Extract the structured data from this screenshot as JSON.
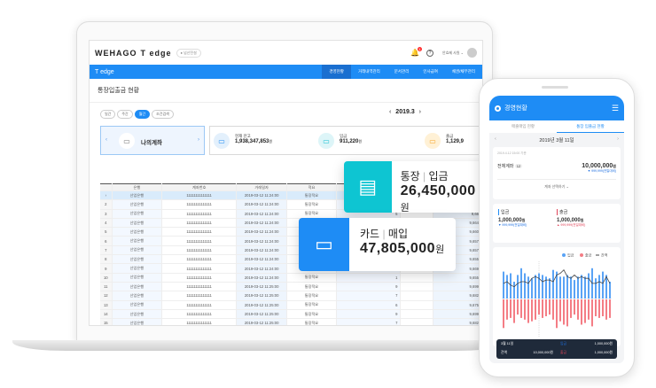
{
  "app": {
    "logo": "WEHAGO",
    "product": "T edge",
    "company_badge": "● 넘산전설",
    "user": "안효제 사원 ⌄",
    "notification_count": "1"
  },
  "nav": {
    "brand": "T edge",
    "items": [
      "경영현황",
      "거래내역관리",
      "문서관리",
      "인사급여",
      "채권/채무관리"
    ]
  },
  "page": {
    "title": "통장입출금 현황",
    "periods": [
      "일간",
      "주간",
      "월간",
      "조건검색"
    ],
    "active_period": "월간",
    "month": "2019.3",
    "prev": "‹",
    "next": "›"
  },
  "account_card": {
    "label": "나의계좌"
  },
  "summary": [
    {
      "label": "현재 잔고",
      "value": "1,938,347,853",
      "unit": "원",
      "color": "#e3f0fc",
      "accent": "#1e8cf5"
    },
    {
      "label": "입금",
      "value": "911,220",
      "unit": "원",
      "color": "#ddf5f8",
      "accent": "#14bfd2"
    },
    {
      "label": "출금",
      "value": "1,129,9",
      "unit": "",
      "color": "#fff1d6",
      "accent": "#f7a326"
    }
  ],
  "table": {
    "headers": [
      "",
      "은행",
      "계좌번호",
      "거래일자",
      "적요",
      "",
      "",
      ""
    ],
    "rows": [
      [
        "›",
        "산업은행",
        "11111111111111",
        "2019-03-12 11:24:00",
        "통장적요",
        "",
        "",
        ""
      ],
      [
        "2",
        "산업은행",
        "11111111111111",
        "2019-03-12 11:24:00",
        "통장적요",
        "",
        "",
        ""
      ],
      [
        "3",
        "산업은행",
        "11111111111111",
        "2019-03-12 11:24:00",
        "통장적요",
        "5",
        "",
        "9,66"
      ],
      [
        "4",
        "산업은행",
        "11111111111111",
        "2019-03-12 11:24:00",
        "통장적요",
        "",
        "",
        "9,664"
      ],
      [
        "5",
        "산업은행",
        "11111111111111",
        "2019-03-12 11:24:00",
        "통장적요",
        "",
        "",
        "9,660"
      ],
      [
        "6",
        "산업은행",
        "11111111111111",
        "2019-03-12 11:24:00",
        "통장적요",
        "",
        "",
        "9,657"
      ],
      [
        "7",
        "산업은행",
        "11111111111111",
        "2019-03-12 11:24:00",
        "통장적요",
        "",
        "",
        "9,657"
      ],
      [
        "8",
        "산업은행",
        "11111111111111",
        "2019-03-12 11:24:00",
        "통장적요",
        "",
        "",
        "9,655"
      ],
      [
        "9",
        "산업은행",
        "11111111111111",
        "2019-03-12 11:24:00",
        "통장적요",
        "",
        "",
        "9,669"
      ],
      [
        "10",
        "산업은행",
        "11111111111111",
        "2019-03-12 11:24:00",
        "통장적요",
        "1",
        "",
        "9,655"
      ],
      [
        "11",
        "산업은행",
        "11111111111111",
        "2019-03-12 11:25:00",
        "통장적요",
        "9",
        "",
        "9,699"
      ],
      [
        "12",
        "산업은행",
        "11111111111111",
        "2019-03-12 11:25:00",
        "통장적요",
        "7",
        "",
        "9,682"
      ],
      [
        "13",
        "산업은행",
        "11111111111111",
        "2019-03-12 11:25:00",
        "통장적요",
        "6",
        "",
        "9,675"
      ],
      [
        "14",
        "산업은행",
        "11111111111111",
        "2019-03-12 11:25:00",
        "통장적요",
        "9",
        "",
        "9,699"
      ],
      [
        "15",
        "산업은행",
        "11111111111111",
        "2019-03-12 11:25:00",
        "통장적요",
        "7",
        "",
        "9,682"
      ]
    ]
  },
  "popup_deposit": {
    "title1": "통장",
    "title2": "입금",
    "amount": "26,450,000",
    "unit": "원",
    "color": "#0ec5d2"
  },
  "popup_card": {
    "title1": "카드",
    "title2": "매입",
    "amount": "47,805,000",
    "unit": "원",
    "color": "#1e8cf5"
  },
  "phone": {
    "title": "경영현황",
    "tabs": [
      "매출매입 현황",
      "통장 입출금 현황"
    ],
    "date": "2019년 3월 11일",
    "asof": "2019.4.12 15:00 기준",
    "total_label": "전체계좌",
    "total_count": "12",
    "total_amount": "10,000,000",
    "unit": "원",
    "total_change": "▼ 999,999(전일대비)",
    "select_accounts": "계좌 선택하기 ⌄",
    "in_label": "입금",
    "in_amount": "1,000,000",
    "in_change": "▼ 999,999(전일대비)",
    "out_label": "출금",
    "out_amount": "1,000,000",
    "out_change": "▲ 999,999(전일대비)",
    "tooltip": {
      "date": "3월 11일",
      "balance_label": "잔액",
      "balance": "10,000,000원",
      "in_label": "입금",
      "in_value": "1,000,000원",
      "out_label": "출금",
      "out_value": "1,000,000원"
    }
  },
  "chart_data": {
    "type": "bar",
    "legend": [
      "입금",
      "출금",
      "잔액"
    ],
    "x_ticks": [
      "1일",
      "5일",
      "10일",
      "15일",
      "20일",
      "25일",
      "30일"
    ],
    "inflow": [
      8,
      7,
      7.5,
      5,
      7,
      9,
      7.5,
      6.5,
      6,
      7,
      7.5,
      7,
      6.5,
      6,
      8.5,
      8,
      6.5,
      6.5,
      7,
      6.5,
      5.5,
      6.5,
      7,
      6.5,
      7.5,
      9,
      6,
      7,
      8,
      7,
      5
    ],
    "outflow": [
      8.5,
      6,
      5.5,
      7,
      4.5,
      5.5,
      6,
      7,
      6.5,
      6,
      4.5,
      5.5,
      5,
      4.5,
      6,
      8.5,
      6.5,
      7.5,
      8,
      5.5,
      4.5,
      6,
      7.5,
      7,
      6,
      8,
      5,
      5.5,
      5,
      6,
      5.5
    ],
    "balance": [
      4.5,
      5,
      4,
      3.5,
      4.5,
      5,
      5,
      4.5,
      6,
      6.5,
      6,
      5,
      5.5,
      5.5,
      5,
      7,
      7.5,
      8.5,
      6.5,
      6,
      7,
      6,
      6.5,
      6,
      6,
      4.5,
      4.5,
      5,
      4.5,
      6.5,
      4.5
    ],
    "colors": {
      "inflow": "#5aa3f5",
      "outflow": "#f47d85",
      "balance": "#444444"
    }
  }
}
